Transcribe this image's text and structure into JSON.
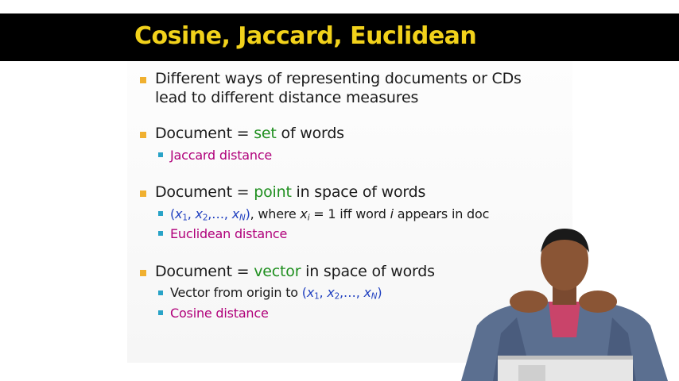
{
  "slide": {
    "title": "Cosine, Jaccard, Euclidean",
    "bullets": [
      {
        "line1": "Different ways of representing documents or CDs",
        "line2": "lead to different distance measures"
      },
      {
        "prefix": "Document = ",
        "keyword": "set",
        "suffix": " of words",
        "sub": [
          {
            "text": "Jaccard distance"
          }
        ]
      },
      {
        "prefix": "Document = ",
        "keyword": "point",
        "suffix": " in space of words",
        "sub": [
          {
            "open": "(",
            "x1": "x",
            "s1": "1",
            "sep1": ", ",
            "x2": "x",
            "s2": "2",
            "sep2": ",…, ",
            "xn": "x",
            "sn": "N",
            "close": ")",
            "where": ", where ",
            "xi": "x",
            "si": "i",
            "eq": " = 1 iff word ",
            "i": "i",
            "rest": " appears in doc"
          },
          {
            "text": "Euclidean distance"
          }
        ]
      },
      {
        "prefix": "Document = ",
        "keyword": "vector",
        "suffix": " in space of words",
        "sub": [
          {
            "lead": "Vector from origin to ",
            "open": "(",
            "x1": "x",
            "s1": "1",
            "sep1": ", ",
            "x2": "x",
            "s2": "2",
            "sep2": ",…, ",
            "xn": "x",
            "sn": "N",
            "close": ")"
          },
          {
            "text": "Cosine distance"
          }
        ]
      }
    ]
  },
  "colors": {
    "title": "#f2d21b",
    "keyword": "#1f8f1f",
    "distance": "#b0007a",
    "math": "#2040c0",
    "bullet_main": "#f0b030",
    "bullet_sub": "#29a3c7"
  },
  "presenter": {
    "icon": "presenter-video"
  }
}
